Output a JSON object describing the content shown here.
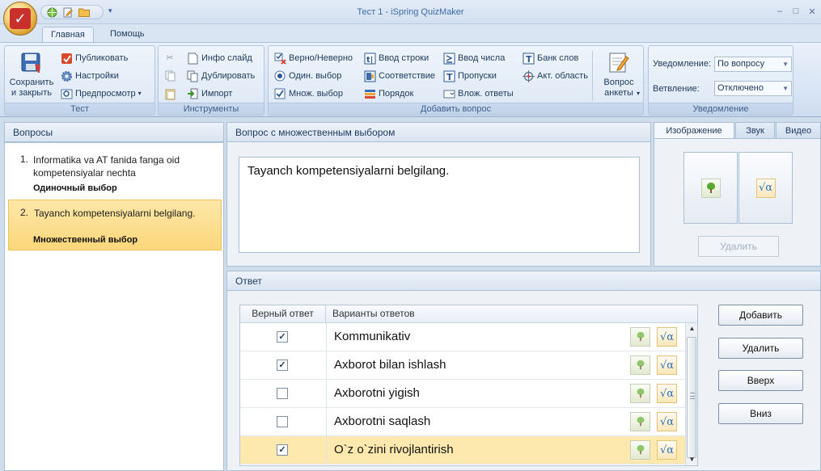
{
  "window": {
    "title": "Тест 1 - iSpring QuizMaker",
    "minimize": "–",
    "maximize": "□"
  },
  "quick_access": {
    "items": [
      "globe-icon",
      "edit-icon",
      "folder-icon"
    ],
    "more": "▾"
  },
  "ribbon_tabs": [
    "Главная",
    "Помощь"
  ],
  "ribbon": {
    "test_group": {
      "label": "Тест",
      "save_close": "Сохранить и закрыть",
      "publish": "Публиковать",
      "settings": "Настройки",
      "preview": "Предпросмотр"
    },
    "tools_group": {
      "label": "Инструменты",
      "info_slide": "Инфо слайд",
      "duplicate": "Дублировать",
      "import": "Импорт"
    },
    "add_question_group": {
      "label": "Добавить вопрос",
      "true_false": "Верно/Неверно",
      "single_choice": "Один. выбор",
      "multi_choice": "Множ. выбор",
      "type_in": "Ввод строки",
      "matching": "Соответствие",
      "sequence": "Порядок",
      "numeric": "Ввод числа",
      "fill_blanks": "Пропуски",
      "multiple_response": "Влож. ответы",
      "word_bank": "Банк слов",
      "hotspot": "Акт. область",
      "survey": "Вопрос анкеты"
    },
    "feedback_group": {
      "label": "Уведомление",
      "feedback_label": "Уведомление:",
      "feedback_value": "По вопросу",
      "branching_label": "Ветвление:",
      "branching_value": "Отключено"
    }
  },
  "questions_panel": {
    "title": "Вопросы",
    "items": [
      {
        "number": "1.",
        "text": "Informatika va AT fanida fanga oid kompetensiyalar nechta",
        "type": "Одиночный выбор"
      },
      {
        "number": "2.",
        "text": "Tayanch kompetensiyalarni belgilang.",
        "type": "Множественный выбор"
      }
    ]
  },
  "question_editor": {
    "title": "Вопрос с множественным выбором",
    "text": "Tayanch kompetensiyalarni belgilang."
  },
  "media": {
    "tabs": [
      "Изображение",
      "Звук",
      "Видео"
    ],
    "delete": "Удалить"
  },
  "answers": {
    "title": "Ответ",
    "col_correct": "Верный ответ",
    "col_options": "Варианты ответов",
    "rows": [
      {
        "text": "Kommunikativ",
        "checked": true
      },
      {
        "text": "Axborot bilan ishlash",
        "checked": true
      },
      {
        "text": "Axborotni yigish",
        "checked": false
      },
      {
        "text": "Axborotni saqlash",
        "checked": false
      },
      {
        "text": "O`z o`zini rivojlantirish",
        "checked": true
      }
    ],
    "buttons": {
      "add": "Добавить",
      "delete": "Удалить",
      "up": "Вверх",
      "down": "Вниз"
    }
  },
  "colors": {
    "accent": "#1e395b",
    "selection": "#fcd77a",
    "ribbon": "#d7e4f4"
  }
}
